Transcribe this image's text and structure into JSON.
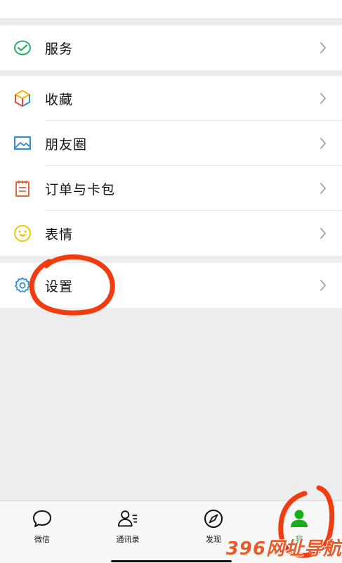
{
  "groups": [
    {
      "items": [
        {
          "label": "服务",
          "icon": "wechat-pay-icon"
        }
      ]
    },
    {
      "items": [
        {
          "label": "收藏",
          "icon": "favorites-cube-icon"
        },
        {
          "label": "朋友圈",
          "icon": "moments-image-icon"
        },
        {
          "label": "订单与卡包",
          "icon": "orders-notepad-icon"
        },
        {
          "label": "表情",
          "icon": "smiley-face-icon"
        }
      ]
    },
    {
      "items": [
        {
          "label": "设置",
          "icon": "gear-icon"
        }
      ]
    }
  ],
  "tabbar": {
    "tabs": [
      {
        "label": "微信",
        "icon": "chat-bubble-icon",
        "active": false
      },
      {
        "label": "通讯录",
        "icon": "contacts-icon",
        "active": false
      },
      {
        "label": "发现",
        "icon": "compass-icon",
        "active": false
      },
      {
        "label": "我",
        "icon": "person-icon",
        "active": true
      }
    ]
  },
  "watermark": {
    "text": "396网址导航"
  },
  "colors": {
    "background": "#ededed",
    "accent_green": "#1aad19",
    "annotation_red": "#f23b0e",
    "chevron": "#b2b2b2"
  }
}
